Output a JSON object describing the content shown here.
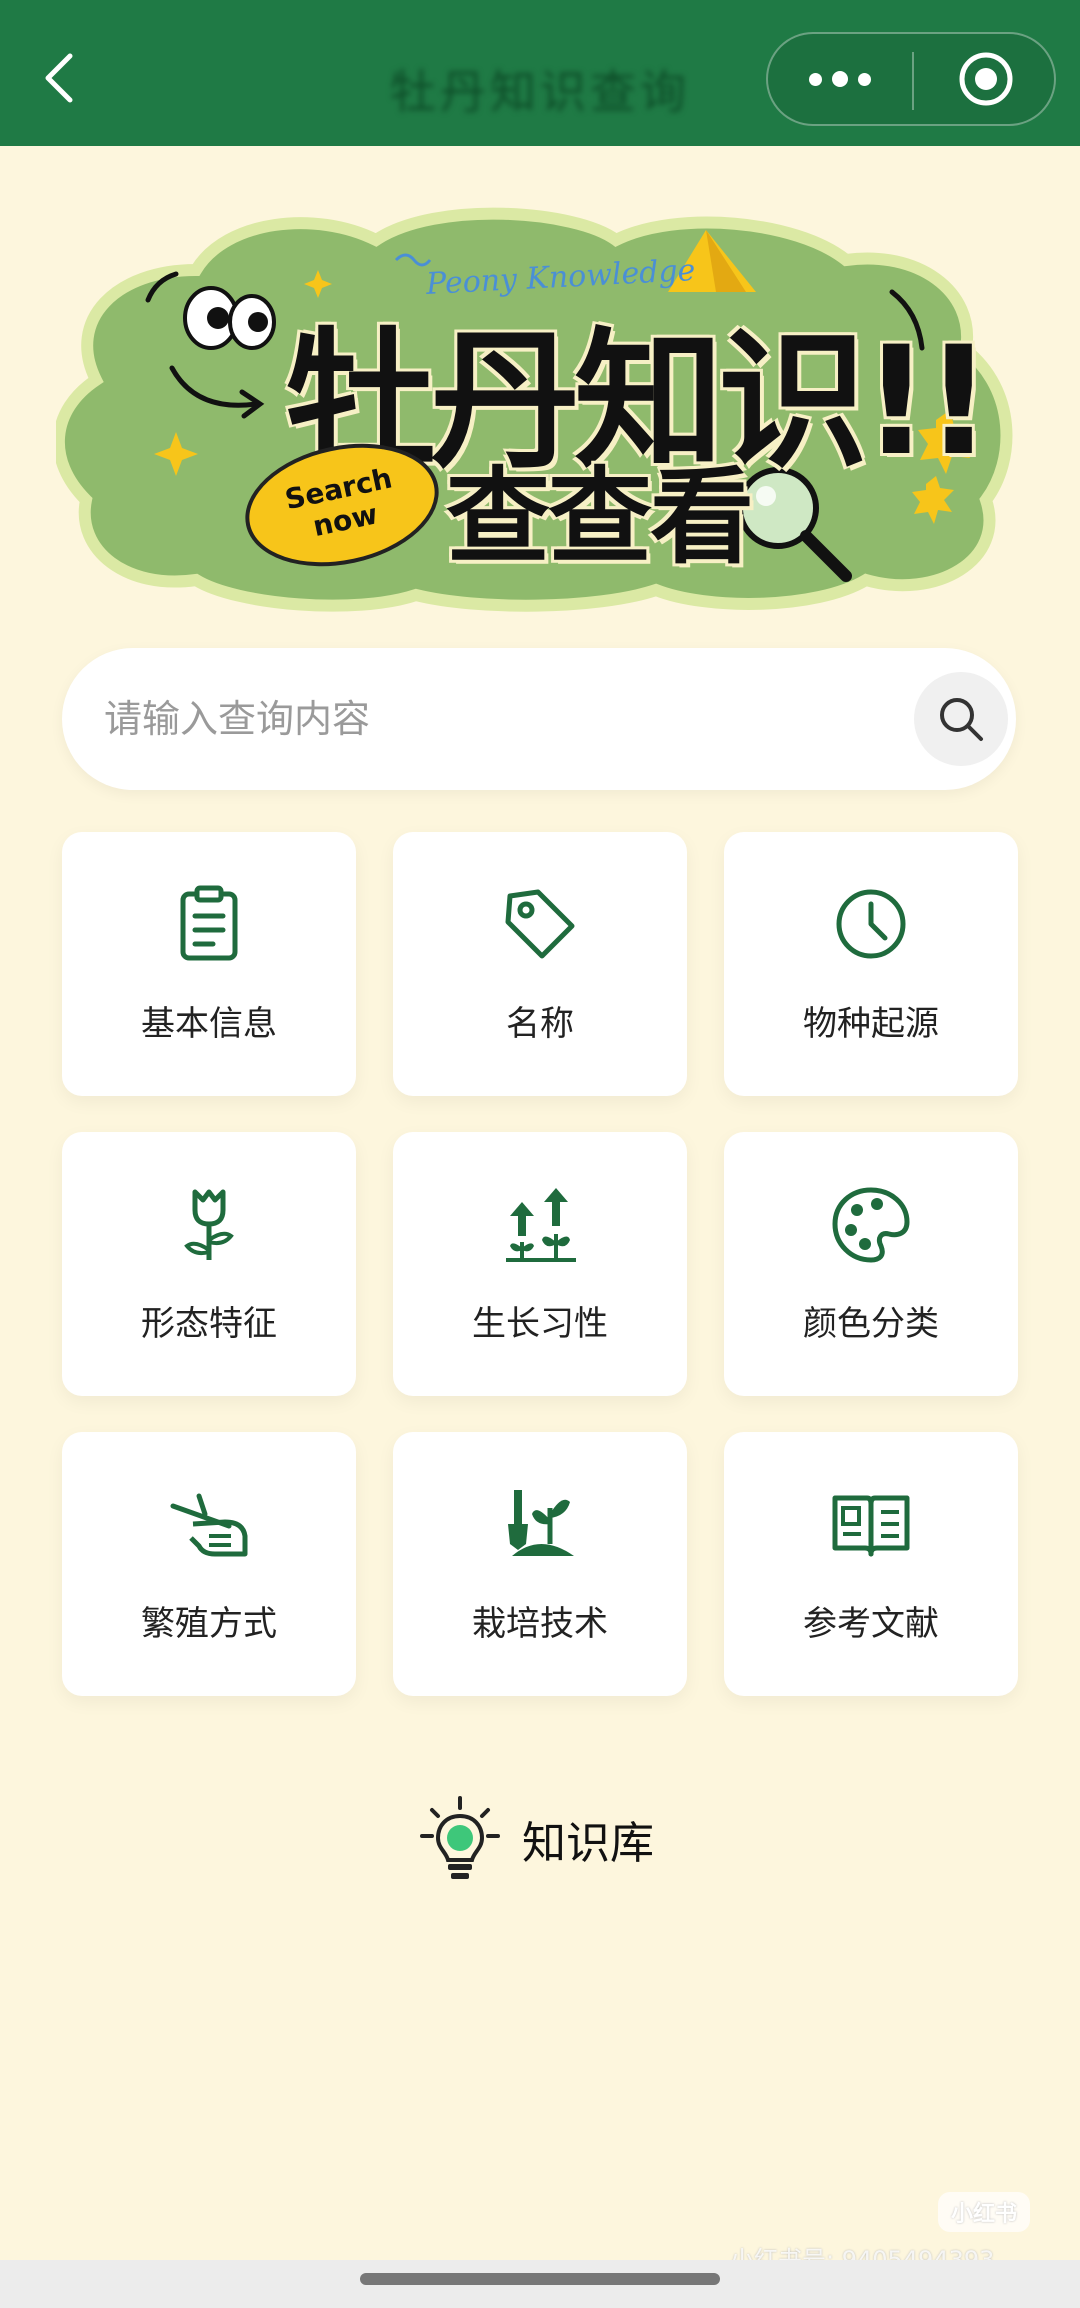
{
  "topbar": {
    "title": "牡丹知识查询",
    "back_icon": "chevron-left-icon",
    "more_icon": "more-dots-icon",
    "close_icon": "target-circle-icon",
    "color": "#1f7a45"
  },
  "banner": {
    "subtitle": "Peony Knowledge",
    "title": "牡丹知识",
    "title_suffix": "!!",
    "subtitle2": "查查看",
    "badge_line1": "Search",
    "badge_line2": "now"
  },
  "search": {
    "placeholder": "请输入查询内容",
    "value": "",
    "icon": "search-icon"
  },
  "categories": [
    {
      "label": "基本信息",
      "icon": "clipboard-icon"
    },
    {
      "label": "名称",
      "icon": "tag-icon"
    },
    {
      "label": "物种起源",
      "icon": "clock-icon"
    },
    {
      "label": "形态特征",
      "icon": "flower-icon"
    },
    {
      "label": "生长习性",
      "icon": "growth-arrows-icon"
    },
    {
      "label": "颜色分类",
      "icon": "palette-icon"
    },
    {
      "label": "繁殖方式",
      "icon": "hand-cutting-icon"
    },
    {
      "label": "栽培技术",
      "icon": "shovel-plant-icon"
    },
    {
      "label": "参考文献",
      "icon": "open-book-icon"
    }
  ],
  "knowledge_base": {
    "label": "知识库",
    "icon": "lightbulb-icon"
  },
  "watermark": {
    "logo": "小红书",
    "text": "小红书号: 9405494393"
  },
  "colors": {
    "accent": "#1f7a45",
    "background": "#fdf6dd",
    "banner_green": "#8fba6c",
    "badge_yellow": "#f7c51a"
  }
}
